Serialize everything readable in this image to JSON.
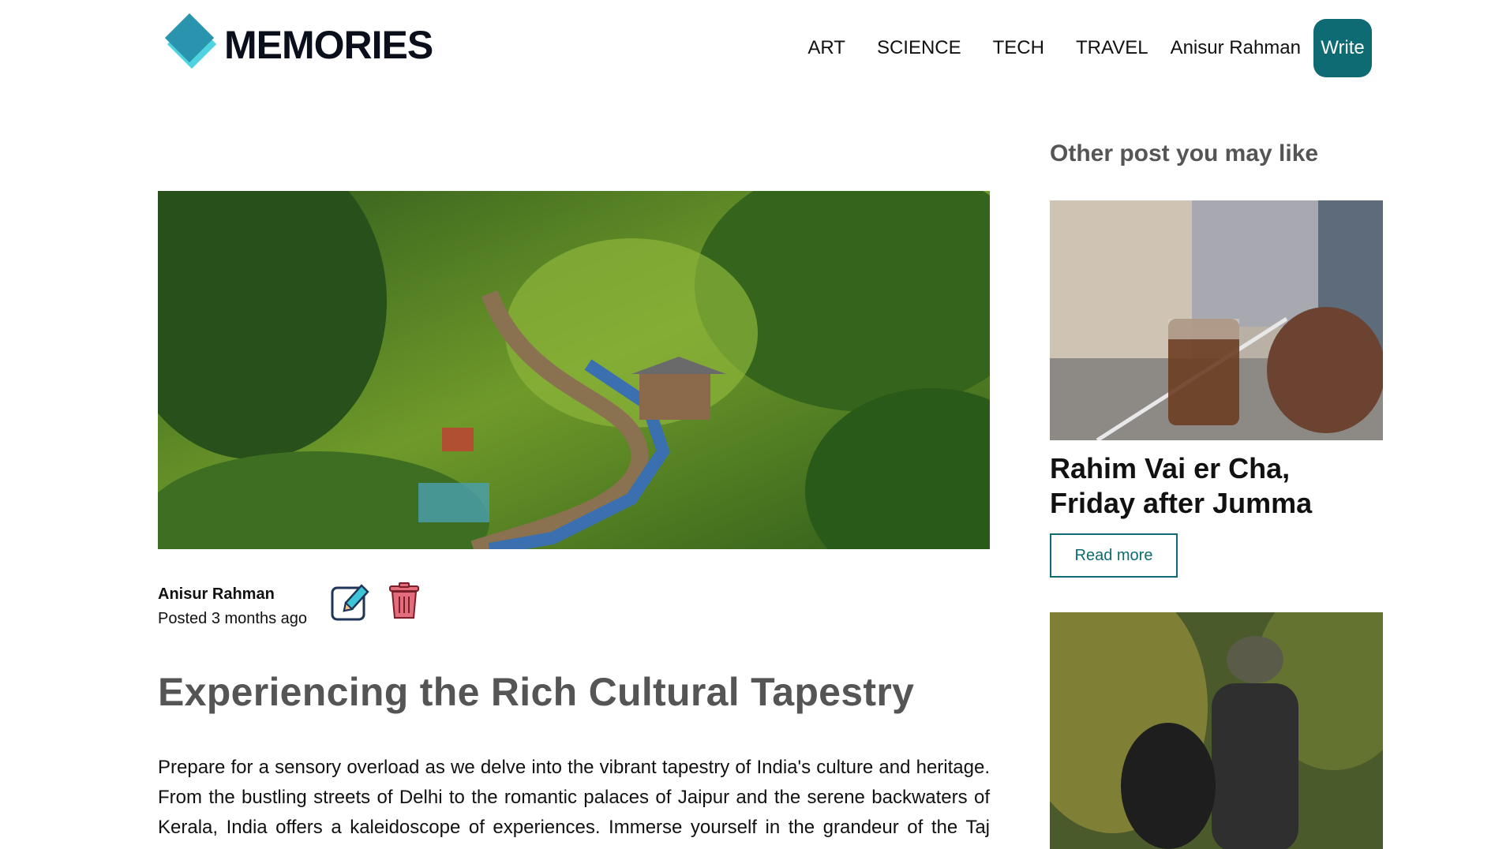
{
  "brand": {
    "name": "MEMORIES"
  },
  "nav": {
    "items": [
      {
        "label": "ART"
      },
      {
        "label": "SCIENCE"
      },
      {
        "label": "TECH"
      },
      {
        "label": "TRAVEL"
      }
    ],
    "user": "Anisur Rahman",
    "write_label": "Write"
  },
  "post": {
    "author": "Anisur Rahman",
    "posted": "Posted 3 months ago",
    "title": "Experiencing the Rich Cultural Tapestry",
    "body": "Prepare for a sensory overload as we delve into the vibrant tapestry of India's culture and heritage. From the bustling streets of Delhi to the romantic palaces of Jaipur and the serene backwaters of Kerala, India offers a kaleidoscope of experiences. Immerse yourself in the grandeur of the Taj Mahal, witness spiritual rituals along the banks of the"
  },
  "sidebar": {
    "title": "Other post you may like",
    "cards": [
      {
        "title": "Rahim Vai er Cha, Friday after Jumma",
        "read_more": "Read more"
      }
    ]
  },
  "colors": {
    "accent": "#0f6b73",
    "logo_dark": "#2a93ad",
    "logo_light": "#4fd3e0"
  },
  "icons": [
    "edit-icon",
    "delete-icon"
  ]
}
